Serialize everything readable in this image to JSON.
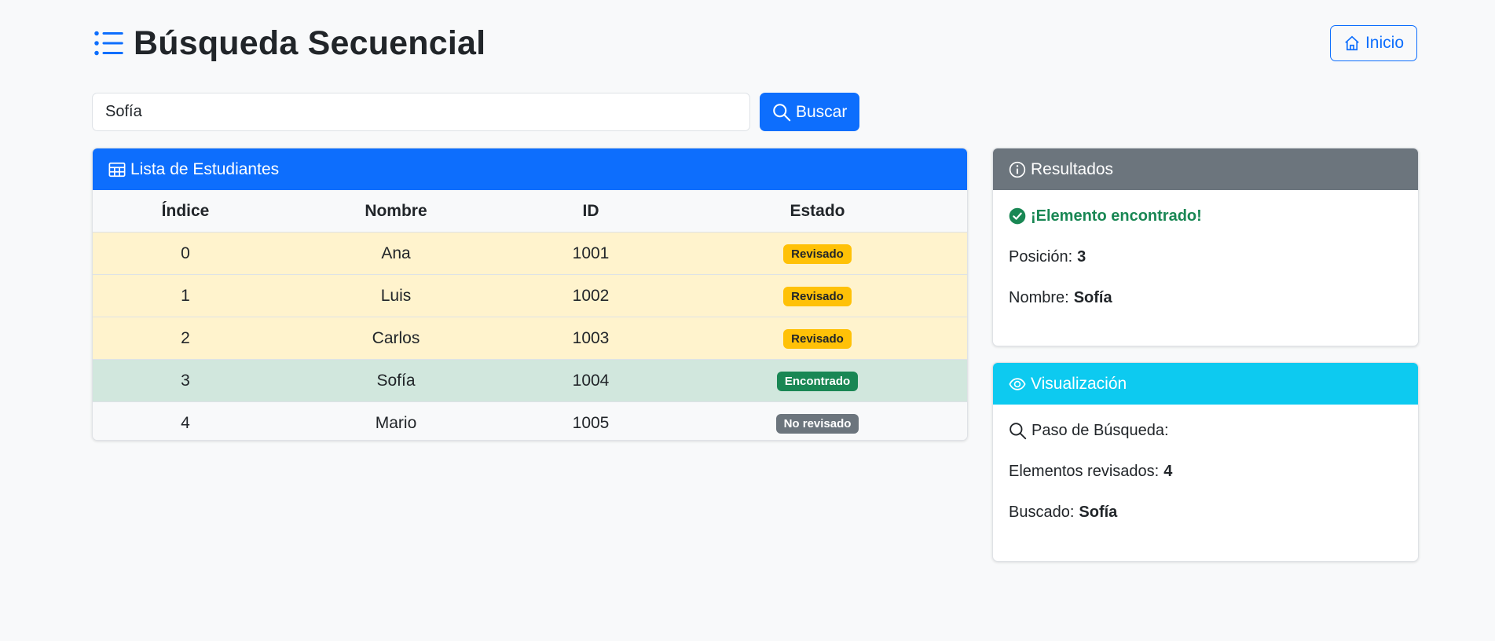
{
  "header": {
    "title": "Búsqueda Secuencial",
    "title_icon": "list-icon",
    "home_label": "Inicio",
    "home_icon": "house-icon"
  },
  "search": {
    "value": "Sofía",
    "button_label": "Buscar",
    "button_icon": "search-icon"
  },
  "table_card": {
    "title": "Lista de Estudiantes",
    "icon": "table-icon",
    "columns": [
      "Índice",
      "Nombre",
      "ID",
      "Estado"
    ],
    "rows": [
      {
        "index": "0",
        "name": "Ana",
        "id": "1001",
        "status": "Revisado"
      },
      {
        "index": "1",
        "name": "Luis",
        "id": "1002",
        "status": "Revisado"
      },
      {
        "index": "2",
        "name": "Carlos",
        "id": "1003",
        "status": "Revisado"
      },
      {
        "index": "3",
        "name": "Sofía",
        "id": "1004",
        "status": "Encontrado"
      },
      {
        "index": "4",
        "name": "Mario",
        "id": "1005",
        "status": "No revisado"
      }
    ]
  },
  "results_card": {
    "title": "Resultados",
    "icon": "info-circle-icon",
    "found_message": "¡Elemento encontrado!",
    "position_label": "Posición:",
    "position_value": "3",
    "name_label": "Nombre:",
    "name_value": "Sofía"
  },
  "viz_card": {
    "title": "Visualización",
    "icon": "eye-icon",
    "step_label": "Paso de Búsqueda:",
    "reviewed_label": "Elementos revisados:",
    "reviewed_value": "4",
    "searched_label": "Buscado:",
    "searched_value": "Sofía"
  },
  "colors": {
    "primary": "#0d6efd",
    "secondary": "#6c757d",
    "info": "#0dcaf0",
    "success": "#198754",
    "warning": "#ffc107",
    "row_reviewed": "#fff3cd",
    "row_found": "#d1e7dd",
    "background": "#f8f9fa"
  }
}
